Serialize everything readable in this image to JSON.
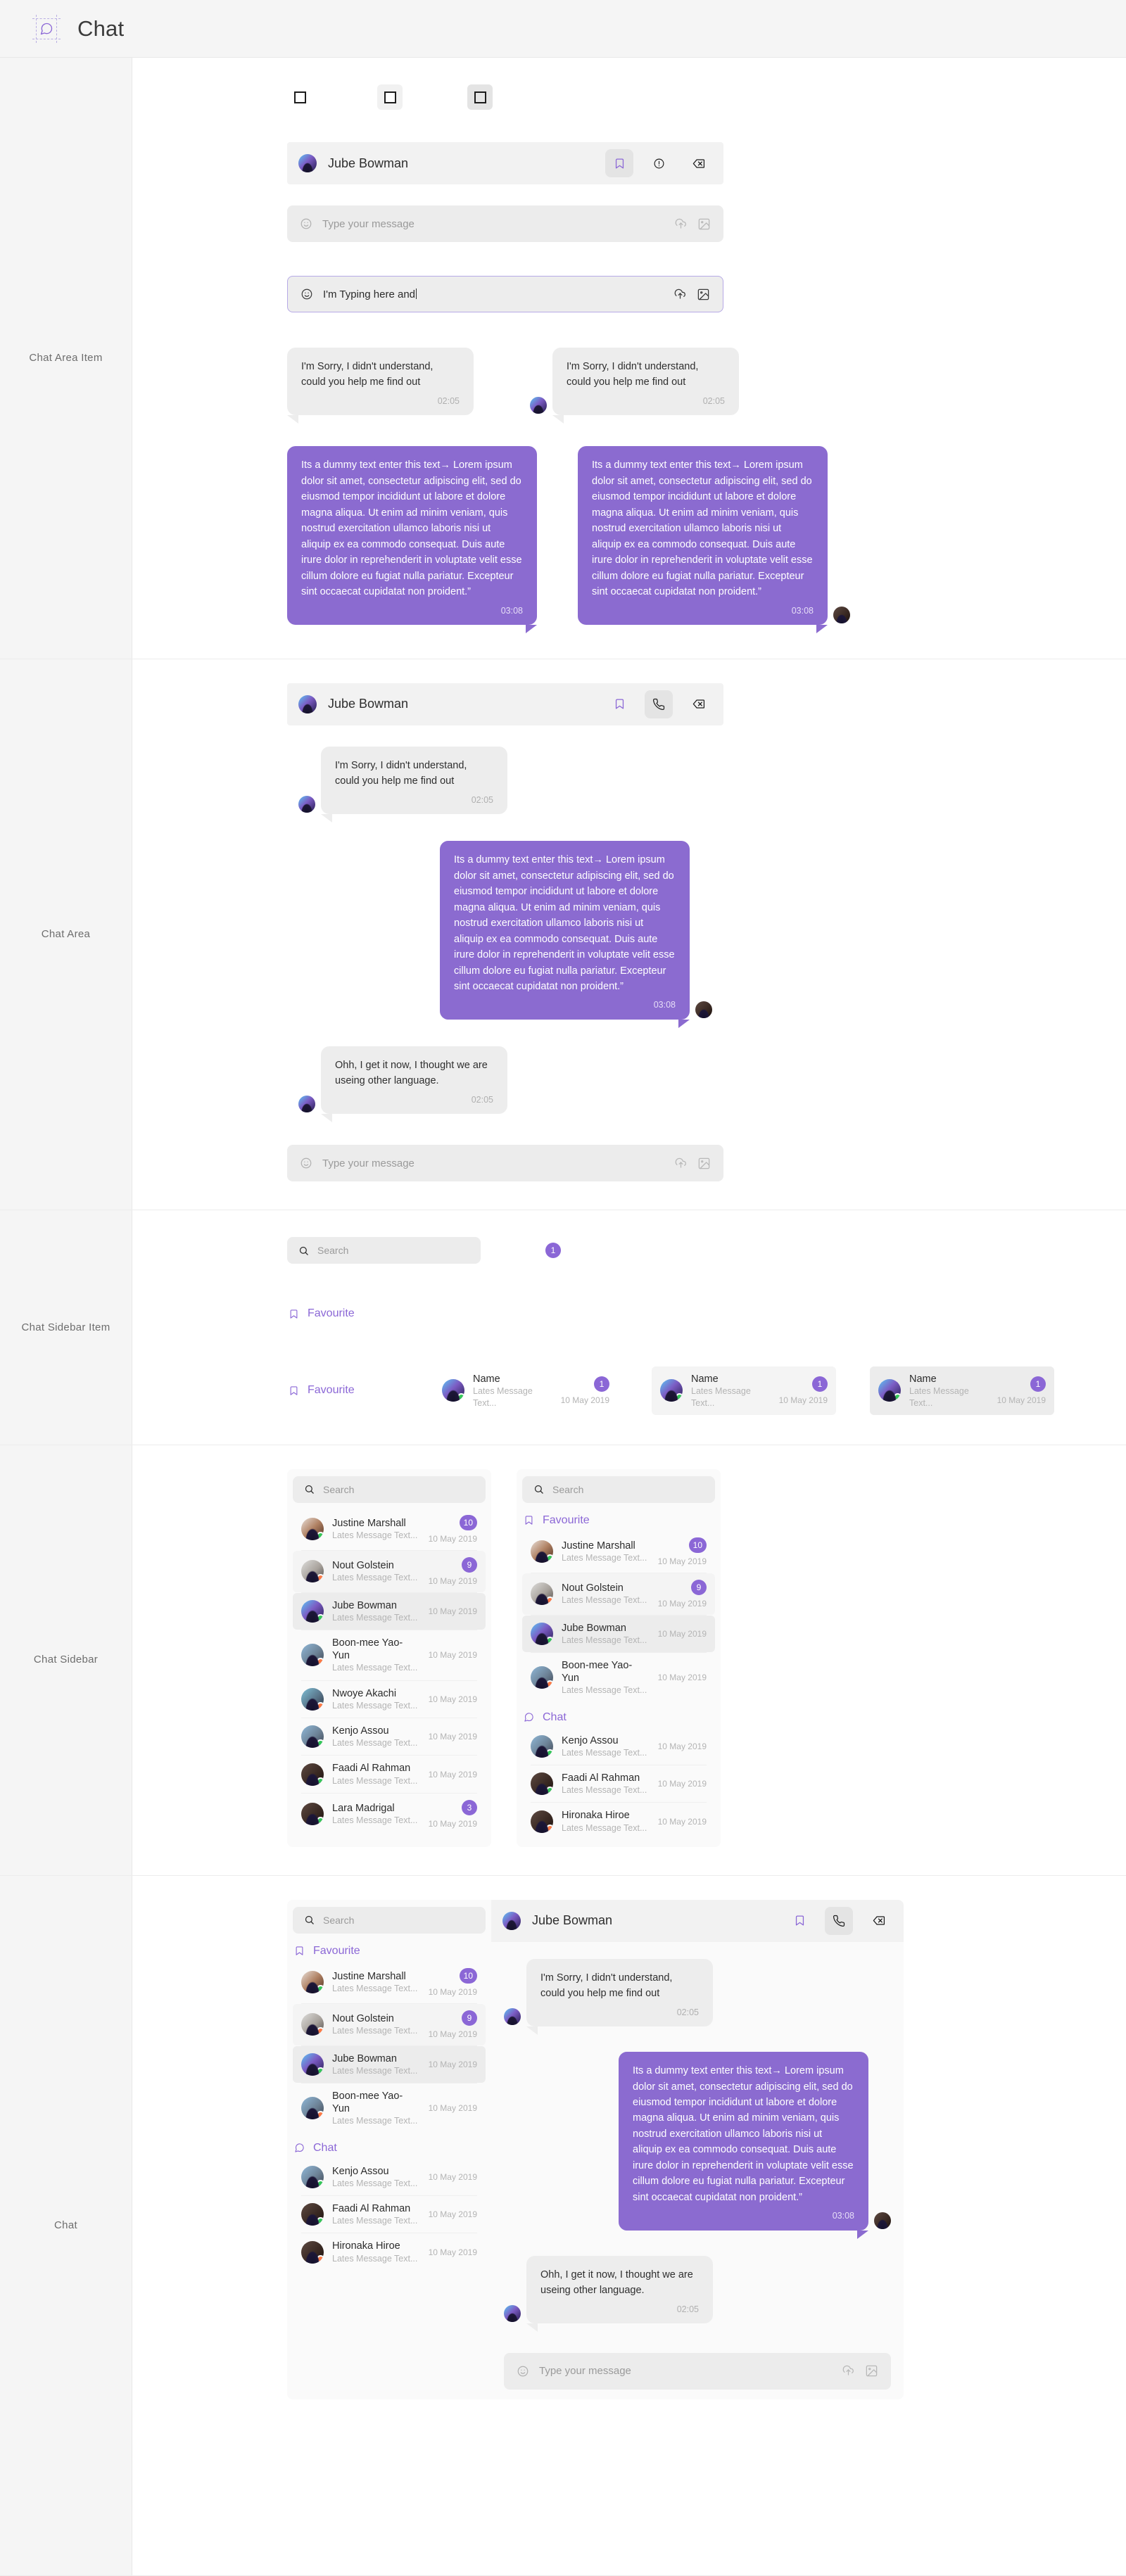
{
  "topbar": {
    "title": "Chat",
    "icon": "chat-bubble-icon"
  },
  "sections": [
    {
      "label": "Chat Area\nItem"
    },
    {
      "label": "Chat Area"
    },
    {
      "label": "Chat Sidebar\nItem"
    },
    {
      "label": "Chat Sidebar"
    },
    {
      "label": "Chat"
    }
  ],
  "section_labels": {
    "chat_area_item": "Chat Area Item",
    "chat_area": "Chat Area",
    "chat_sidebar_item": "Chat Sidebar Item",
    "chat_sidebar": "Chat Sidebar",
    "chat": "Chat"
  },
  "colors": {
    "accent_purple": "#8b67d6",
    "bubble_purple": "#8b6bd0",
    "bubble_grey": "#ededed",
    "panel_grey": "#f2f2f2",
    "input_grey": "#ececec",
    "online_green": "#34c759",
    "away_orange": "#ff7a45"
  },
  "chat_header": {
    "name": "Jube Bowman",
    "icons_variant_a": [
      "bookmark-icon",
      "exclamation-circle-icon",
      "backspace-delete-icon"
    ],
    "icons_variant_b": [
      "bookmark-icon",
      "phone-icon",
      "backspace-delete-icon"
    ]
  },
  "composer": {
    "placeholder": "Type your message",
    "typed_value": "I'm Typing here and",
    "icons": [
      "emoji-smiley-icon",
      "upload-cloud-icon",
      "image-icon"
    ]
  },
  "search": {
    "placeholder": "Search",
    "icon": "search-icon"
  },
  "groups": {
    "favourite": "Favourite",
    "chat": "Chat"
  },
  "messages": {
    "incoming_short": "I'm Sorry, I didn't understand, could you help me find out",
    "incoming_short_time": "02:05",
    "incoming_second": "Ohh, I get it now, I thought we are useing other language.",
    "incoming_second_time": "02:05",
    "outgoing_long": "Its a dummy text enter this text→ Lorem ipsum dolor sit amet, consectetur adipiscing elit, sed do eiusmod tempor incididunt ut labore et dolore magna aliqua. Ut enim ad minim veniam, quis nostrud exercitation ullamco laboris nisi ut aliquip ex ea commodo consequat. Duis aute irure dolor in reprehenderit in voluptate velit esse cillum dolore eu fugiat nulla pariatur. Excepteur sint occaecat cupidatat non proident.”",
    "outgoing_long_time": "03:08"
  },
  "sidebar_item_demo": {
    "name": "Name",
    "last_message": "Lates Message Text...",
    "date": "10 May 2019",
    "badge": "1"
  },
  "sidebar_list_plain": [
    {
      "name": "Justine Marshall",
      "last_message": "Lates Message Text...",
      "date": "10 May 2019",
      "badge": "10",
      "status": "online",
      "state": "default"
    },
    {
      "name": "Nout Golstein",
      "last_message": "Lates Message Text...",
      "date": "10 May 2019",
      "badge": "9",
      "status": "away",
      "state": "hover"
    },
    {
      "name": "Jube Bowman",
      "last_message": "Lates Message Text...",
      "date": "10 May 2019",
      "badge": "",
      "status": "online",
      "state": "selected"
    },
    {
      "name": "Boon-mee Yao-Yun",
      "last_message": "Lates Message Text...",
      "date": "10 May 2019",
      "badge": "",
      "status": "away",
      "state": "default"
    },
    {
      "name": "Nwoye Akachi",
      "last_message": "Lates Message Text...",
      "date": "10 May 2019",
      "badge": "",
      "status": "away",
      "state": "default"
    },
    {
      "name": "Kenjo Assou",
      "last_message": "Lates Message Text...",
      "date": "10 May 2019",
      "badge": "",
      "status": "online",
      "state": "default"
    },
    {
      "name": "Faadi Al Rahman",
      "last_message": "Lates Message Text...",
      "date": "10 May 2019",
      "badge": "",
      "status": "online",
      "state": "default"
    },
    {
      "name": "Lara Madrigal",
      "last_message": "Lates Message Text...",
      "date": "10 May 2019",
      "badge": "3",
      "status": "online",
      "state": "default"
    }
  ],
  "sidebar_grouped": {
    "favourite_items": [
      {
        "name": "Justine Marshall",
        "last_message": "Lates Message Text...",
        "date": "10 May 2019",
        "badge": "10",
        "status": "online",
        "state": "default"
      },
      {
        "name": "Nout Golstein",
        "last_message": "Lates Message Text...",
        "date": "10 May 2019",
        "badge": "9",
        "status": "away",
        "state": "hover"
      },
      {
        "name": "Jube Bowman",
        "last_message": "Lates Message Text...",
        "date": "10 May 2019",
        "badge": "",
        "status": "online",
        "state": "selected"
      },
      {
        "name": "Boon-mee Yao-Yun",
        "last_message": "Lates Message Text...",
        "date": "10 May 2019",
        "badge": "",
        "status": "away",
        "state": "default"
      }
    ],
    "chat_items": [
      {
        "name": "Kenjo Assou",
        "last_message": "Lates Message Text...",
        "date": "10 May 2019",
        "badge": "",
        "status": "online",
        "state": "default"
      },
      {
        "name": "Faadi Al Rahman",
        "last_message": "Lates Message Text...",
        "date": "10 May 2019",
        "badge": "",
        "status": "online",
        "state": "default"
      },
      {
        "name": "Hironaka Hiroe",
        "last_message": "Lates Message Text...",
        "date": "10 May 2019",
        "badge": "",
        "status": "away",
        "state": "default"
      }
    ]
  }
}
